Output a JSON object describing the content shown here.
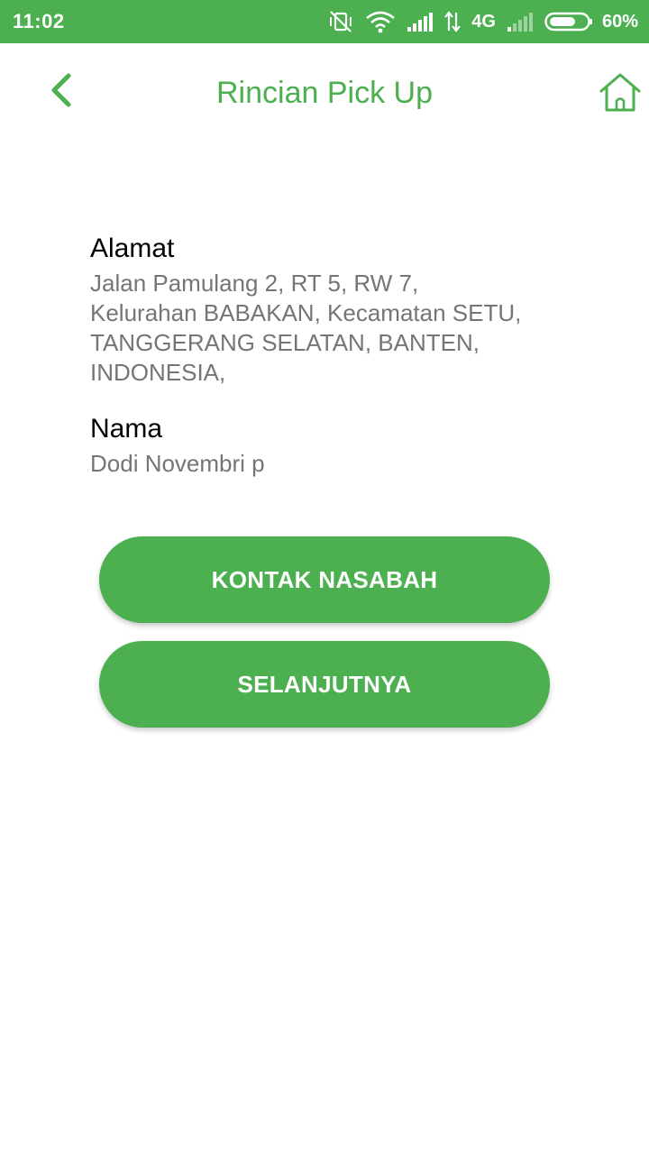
{
  "status_bar": {
    "time": "11:02",
    "network": "4G",
    "battery": "60%",
    "icons": [
      "vibrate-icon",
      "wifi-icon",
      "signal-icon",
      "data-arrows-icon",
      "signal-weak-icon",
      "battery-icon"
    ]
  },
  "header": {
    "title": "Rincian Pick Up",
    "back_icon": "chevron-left-icon",
    "home_icon": "home-icon"
  },
  "address": {
    "label": "Alamat",
    "lines": [
      "Jalan Pamulang 2, RT 5, RW 7,",
      "Kelurahan BABAKAN, Kecamatan SETU,",
      "TANGGERANG SELATAN, BANTEN,",
      "INDONESIA,"
    ]
  },
  "name": {
    "label": "Nama",
    "value": "Dodi Novembri p"
  },
  "actions": {
    "contact_label": "KONTAK NASABAH",
    "next_label": "SELANJUTNYA"
  },
  "colors": {
    "primary": "#4caf50",
    "label_text": "#000000",
    "value_text": "#757575",
    "background": "#ffffff"
  }
}
